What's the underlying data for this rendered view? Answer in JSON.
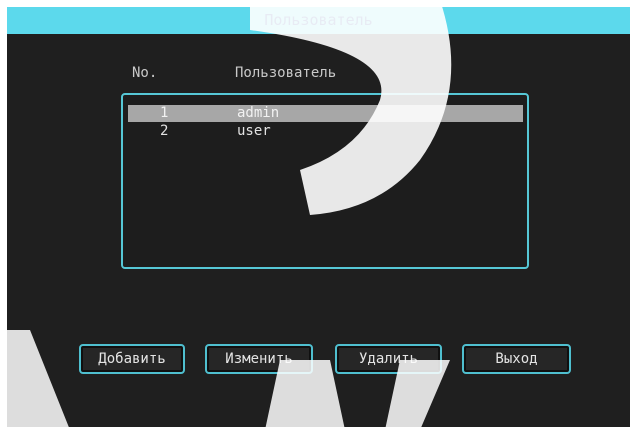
{
  "window": {
    "title": "Пользователь"
  },
  "table": {
    "headers": [
      "No.",
      "Пользователь"
    ],
    "rows": [
      {
        "no": "1",
        "user": "admin",
        "selected": true
      },
      {
        "no": "2",
        "user": "user",
        "selected": false
      }
    ]
  },
  "buttons": {
    "add": "Добавить",
    "edit": "Изменить",
    "delete": "Удалить",
    "exit": "Выход"
  },
  "colors": {
    "titlebar": "#5cd9ec",
    "title_text": "#1b3a8a",
    "accent_border": "#56c7d6",
    "background": "#1f1f1f",
    "selected_row": "#a7a7a7"
  }
}
